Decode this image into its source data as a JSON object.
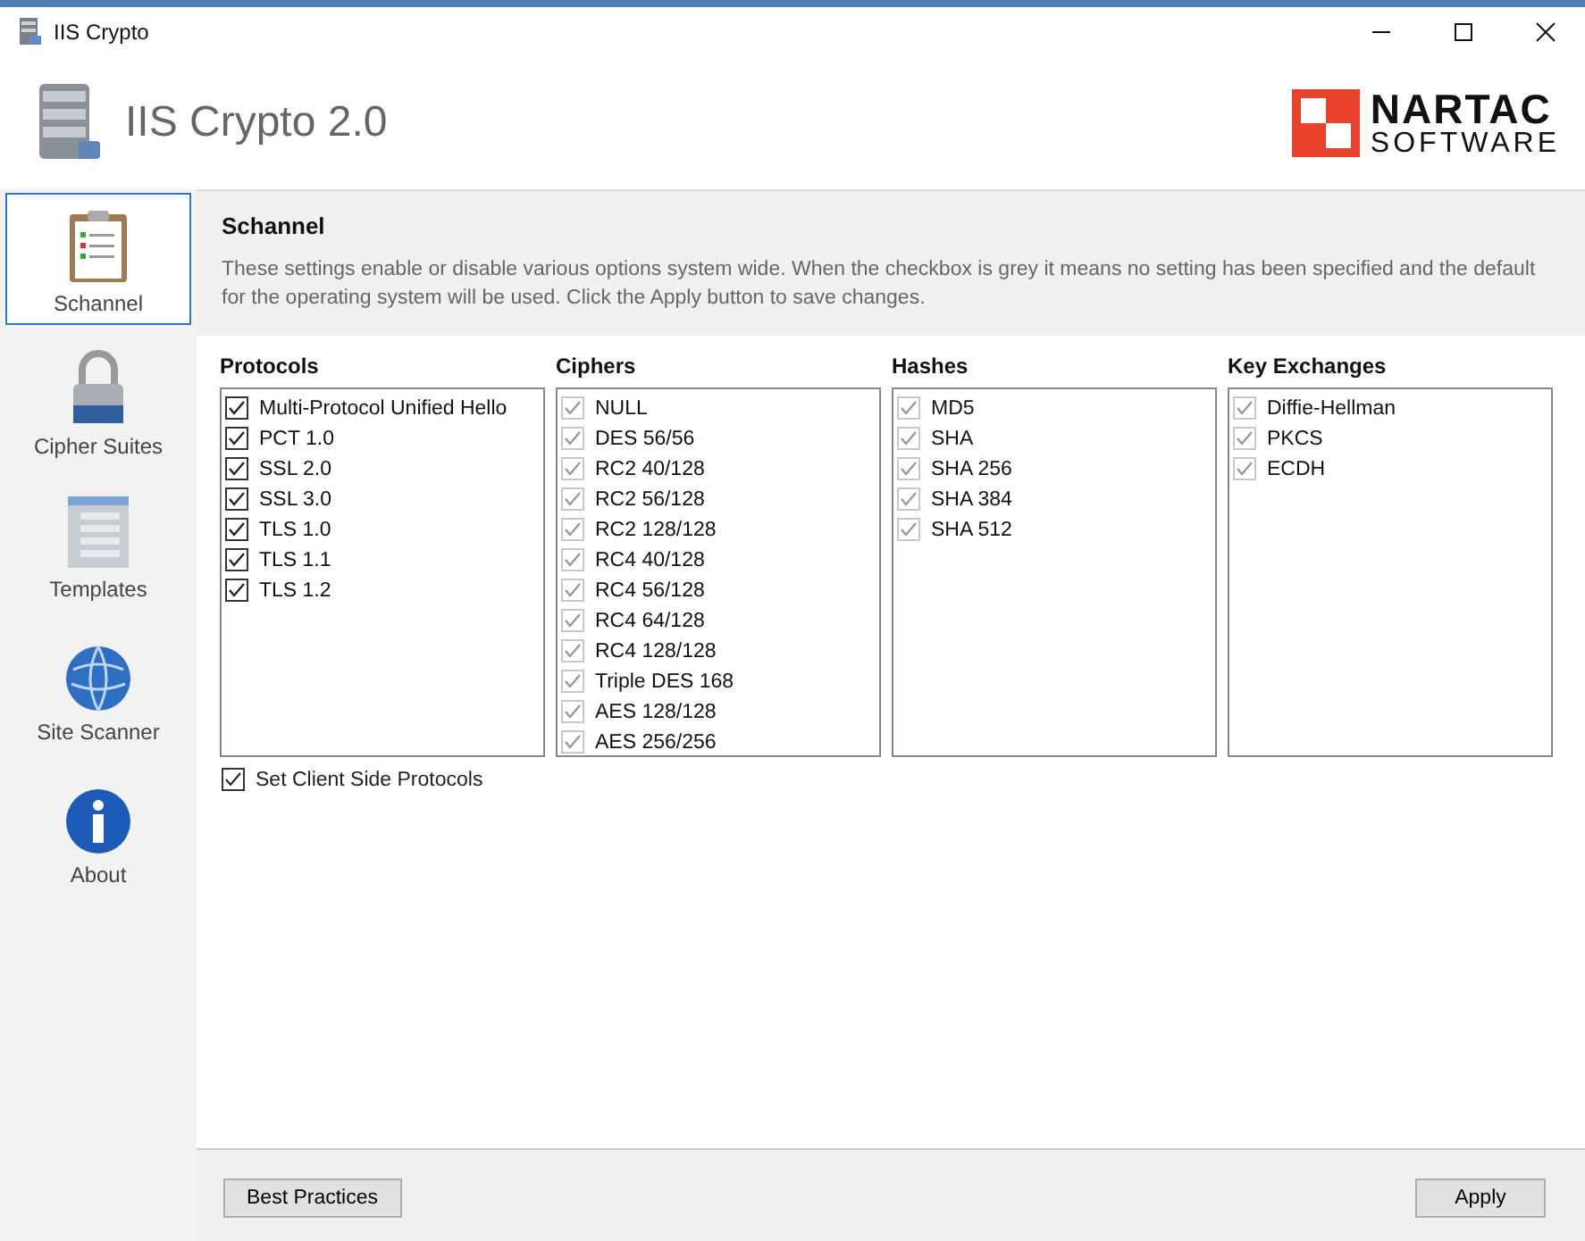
{
  "window": {
    "title": "IIS Crypto"
  },
  "header": {
    "app_name": "IIS Crypto 2.0",
    "logo_top": "NARTAC",
    "logo_bottom": "SOFTWARE"
  },
  "sidebar": {
    "items": [
      {
        "label": "Schannel",
        "selected": true
      },
      {
        "label": "Cipher Suites",
        "selected": false
      },
      {
        "label": "Templates",
        "selected": false
      },
      {
        "label": "Site Scanner",
        "selected": false
      },
      {
        "label": "About",
        "selected": false
      }
    ]
  },
  "section": {
    "title": "Schannel",
    "description": "These settings enable or disable various options system wide. When the checkbox is grey it means no setting has been specified and the default for the operating system will be used. Click the Apply button to save changes."
  },
  "groups": [
    {
      "title": "Protocols",
      "items": [
        {
          "label": "Multi-Protocol Unified Hello",
          "checked": true,
          "kind": "set"
        },
        {
          "label": "PCT 1.0",
          "checked": true,
          "kind": "set"
        },
        {
          "label": "SSL 2.0",
          "checked": true,
          "kind": "set"
        },
        {
          "label": "SSL 3.0",
          "checked": true,
          "kind": "set"
        },
        {
          "label": "TLS 1.0",
          "checked": true,
          "kind": "set"
        },
        {
          "label": "TLS 1.1",
          "checked": true,
          "kind": "set"
        },
        {
          "label": "TLS 1.2",
          "checked": true,
          "kind": "set"
        }
      ]
    },
    {
      "title": "Ciphers",
      "items": [
        {
          "label": "NULL",
          "checked": true,
          "kind": "default"
        },
        {
          "label": "DES 56/56",
          "checked": true,
          "kind": "default"
        },
        {
          "label": "RC2 40/128",
          "checked": true,
          "kind": "default"
        },
        {
          "label": "RC2 56/128",
          "checked": true,
          "kind": "default"
        },
        {
          "label": "RC2 128/128",
          "checked": true,
          "kind": "default"
        },
        {
          "label": "RC4 40/128",
          "checked": true,
          "kind": "default"
        },
        {
          "label": "RC4 56/128",
          "checked": true,
          "kind": "default"
        },
        {
          "label": "RC4 64/128",
          "checked": true,
          "kind": "default"
        },
        {
          "label": "RC4 128/128",
          "checked": true,
          "kind": "default"
        },
        {
          "label": "Triple DES 168",
          "checked": true,
          "kind": "default"
        },
        {
          "label": "AES 128/128",
          "checked": true,
          "kind": "default"
        },
        {
          "label": "AES 256/256",
          "checked": true,
          "kind": "default"
        }
      ]
    },
    {
      "title": "Hashes",
      "items": [
        {
          "label": "MD5",
          "checked": true,
          "kind": "default"
        },
        {
          "label": "SHA",
          "checked": true,
          "kind": "default"
        },
        {
          "label": "SHA 256",
          "checked": true,
          "kind": "default"
        },
        {
          "label": "SHA 384",
          "checked": true,
          "kind": "default"
        },
        {
          "label": "SHA 512",
          "checked": true,
          "kind": "default"
        }
      ]
    },
    {
      "title": "Key Exchanges",
      "items": [
        {
          "label": "Diffie-Hellman",
          "checked": true,
          "kind": "default"
        },
        {
          "label": "PKCS",
          "checked": true,
          "kind": "default"
        },
        {
          "label": "ECDH",
          "checked": true,
          "kind": "default"
        }
      ]
    }
  ],
  "client_side": {
    "label": "Set Client Side Protocols",
    "checked": true
  },
  "buttons": {
    "best_practices": "Best Practices",
    "apply": "Apply"
  }
}
